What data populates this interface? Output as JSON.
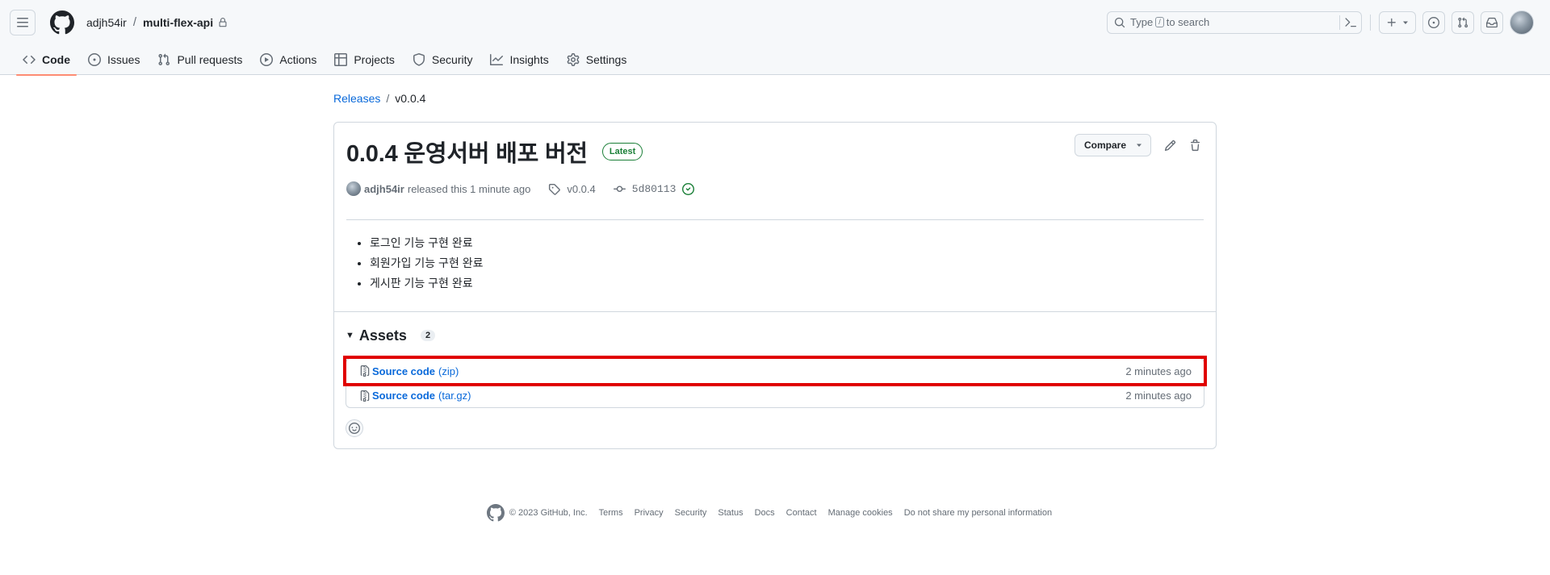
{
  "header": {
    "owner": "adjh54ir",
    "separator": "/",
    "repo": "multi-flex-api",
    "search": {
      "prefix": "Type",
      "key": "/",
      "suffix": "to search"
    }
  },
  "tabs": [
    {
      "label": "Code",
      "icon": "code-icon",
      "active": true
    },
    {
      "label": "Issues",
      "icon": "issue-opened-icon"
    },
    {
      "label": "Pull requests",
      "icon": "git-pull-request-icon"
    },
    {
      "label": "Actions",
      "icon": "play-icon"
    },
    {
      "label": "Projects",
      "icon": "table-icon"
    },
    {
      "label": "Security",
      "icon": "shield-icon"
    },
    {
      "label": "Insights",
      "icon": "graph-icon"
    },
    {
      "label": "Settings",
      "icon": "gear-icon"
    }
  ],
  "breadcrumb": {
    "releases": "Releases",
    "current": "v0.0.4"
  },
  "release": {
    "title": "0.0.4 운영서버 배포 버전",
    "badge": "Latest",
    "compare_label": "Compare",
    "author": "adjh54ir",
    "released_text": "released this 1 minute ago",
    "tag": "v0.0.4",
    "commit": "5d80113",
    "notes": [
      "로그인 기능 구현 완료",
      "회원가입 기능 구현 완료",
      "게시판 기능 구현 완료"
    ]
  },
  "assets": {
    "title": "Assets",
    "count": "2",
    "items": [
      {
        "name": "Source code",
        "ext": "(zip)",
        "time": "2 minutes ago",
        "highlighted": true
      },
      {
        "name": "Source code",
        "ext": "(tar.gz)",
        "time": "2 minutes ago"
      }
    ]
  },
  "footer": {
    "copyright": "© 2023 GitHub, Inc.",
    "links": [
      "Terms",
      "Privacy",
      "Security",
      "Status",
      "Docs",
      "Contact",
      "Manage cookies",
      "Do not share my personal information"
    ]
  },
  "colors": {
    "accent": "#0969da",
    "tab_underline": "#fd8c73",
    "latest_green": "#1a7f37",
    "highlight_red": "#e00000"
  }
}
